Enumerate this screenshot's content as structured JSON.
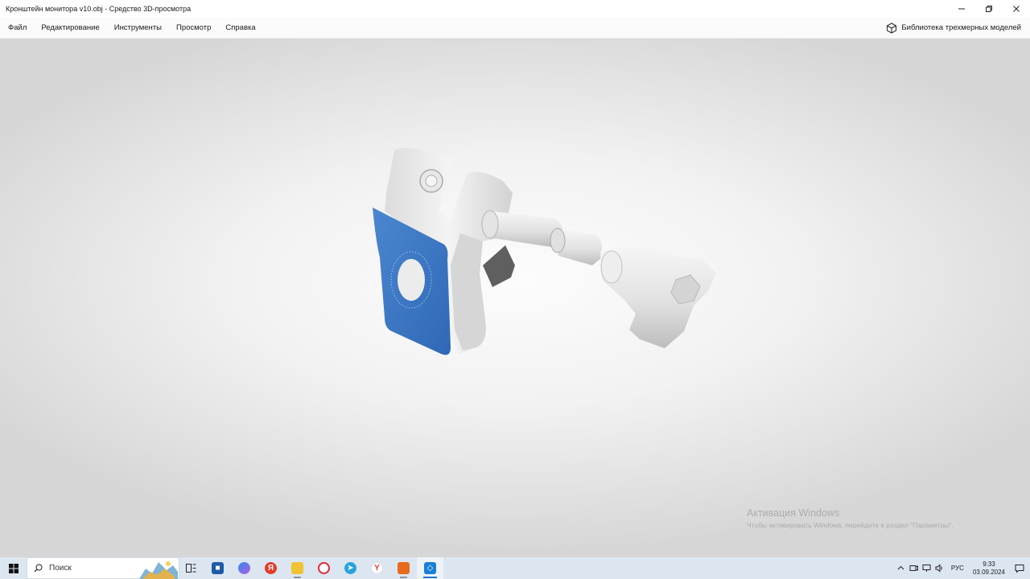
{
  "window": {
    "title": "Кронштейн монитора v10.obj - Средство 3D-просмотра"
  },
  "menu": {
    "items": [
      "Файл",
      "Редактирование",
      "Инструменты",
      "Просмотр",
      "Справка"
    ],
    "library_label": "Библиотека трехмерных моделей"
  },
  "watermark": {
    "line1": "Активация Windows",
    "line2": "Чтобы активировать Windows, перейдите в раздел \"Параметры\"."
  },
  "taskbar": {
    "search_placeholder": "Поиск",
    "language": "РУС",
    "time": "9:33",
    "date": "03.09.2024"
  },
  "colors": {
    "accent_blue": "#3a78c8",
    "model_white": "#ececec",
    "taskbar_bg": "#dce6f1"
  },
  "icons": {
    "library": "cube-icon",
    "start": "windows-logo-icon",
    "search": "magnifier-icon"
  }
}
